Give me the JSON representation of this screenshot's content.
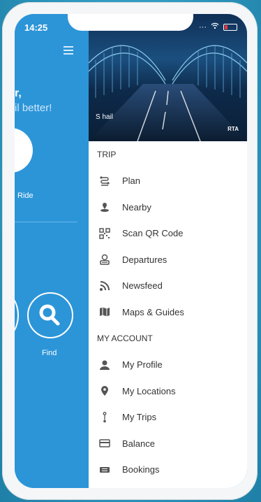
{
  "status_bar": {
    "time": "14:25"
  },
  "background": {
    "greeting_line1": "r,",
    "greeting_line2": "il better!",
    "ride_label": "Ride",
    "find_label": "Find"
  },
  "banner": {
    "logo_text": "S hail",
    "rta_text": "RTA"
  },
  "menu": {
    "trip_header": "TRIP",
    "trip_items": [
      {
        "label": "Plan",
        "icon": "route-icon"
      },
      {
        "label": "Nearby",
        "icon": "location-pin-icon"
      },
      {
        "label": "Scan QR Code",
        "icon": "qr-code-icon"
      },
      {
        "label": "Departures",
        "icon": "departures-icon"
      },
      {
        "label": "Newsfeed",
        "icon": "rss-icon"
      },
      {
        "label": "Maps & Guides",
        "icon": "map-icon"
      }
    ],
    "account_header": "MY ACCOUNT",
    "account_items": [
      {
        "label": "My Profile",
        "icon": "profile-icon"
      },
      {
        "label": "My Locations",
        "icon": "pin-icon"
      },
      {
        "label": "My Trips",
        "icon": "trips-icon"
      },
      {
        "label": "Balance",
        "icon": "card-icon"
      },
      {
        "label": "Bookings",
        "icon": "ticket-icon"
      }
    ]
  }
}
